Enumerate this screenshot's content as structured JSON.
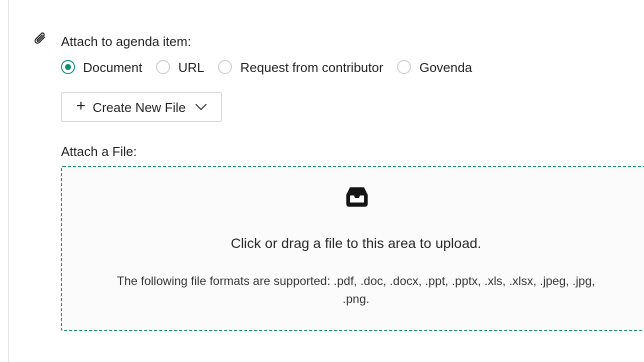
{
  "attach": {
    "label": "Attach to agenda item:",
    "options": [
      {
        "label": "Document",
        "selected": true
      },
      {
        "label": "URL",
        "selected": false
      },
      {
        "label": "Request from contributor",
        "selected": false
      },
      {
        "label": "Govenda",
        "selected": false
      }
    ]
  },
  "create_button": {
    "plus": "+",
    "label": "Create New File"
  },
  "file": {
    "label": "Attach a File:"
  },
  "dropzone": {
    "title": "Click or drag a file to this area to upload.",
    "hint_line1": "The following file formats are supported: .pdf, .doc, .docx, .ppt, .pptx, .xls, .xlsx, .jpeg, .jpg,",
    "hint_line2": ".png."
  },
  "colors": {
    "accent": "#0e8f72",
    "dropzone_border": "#1b8e6e",
    "border": "#d9d9d9"
  },
  "icons": {
    "attach": "paperclip-icon",
    "dropdown": "chevron-down-icon",
    "upload": "inbox-icon"
  }
}
